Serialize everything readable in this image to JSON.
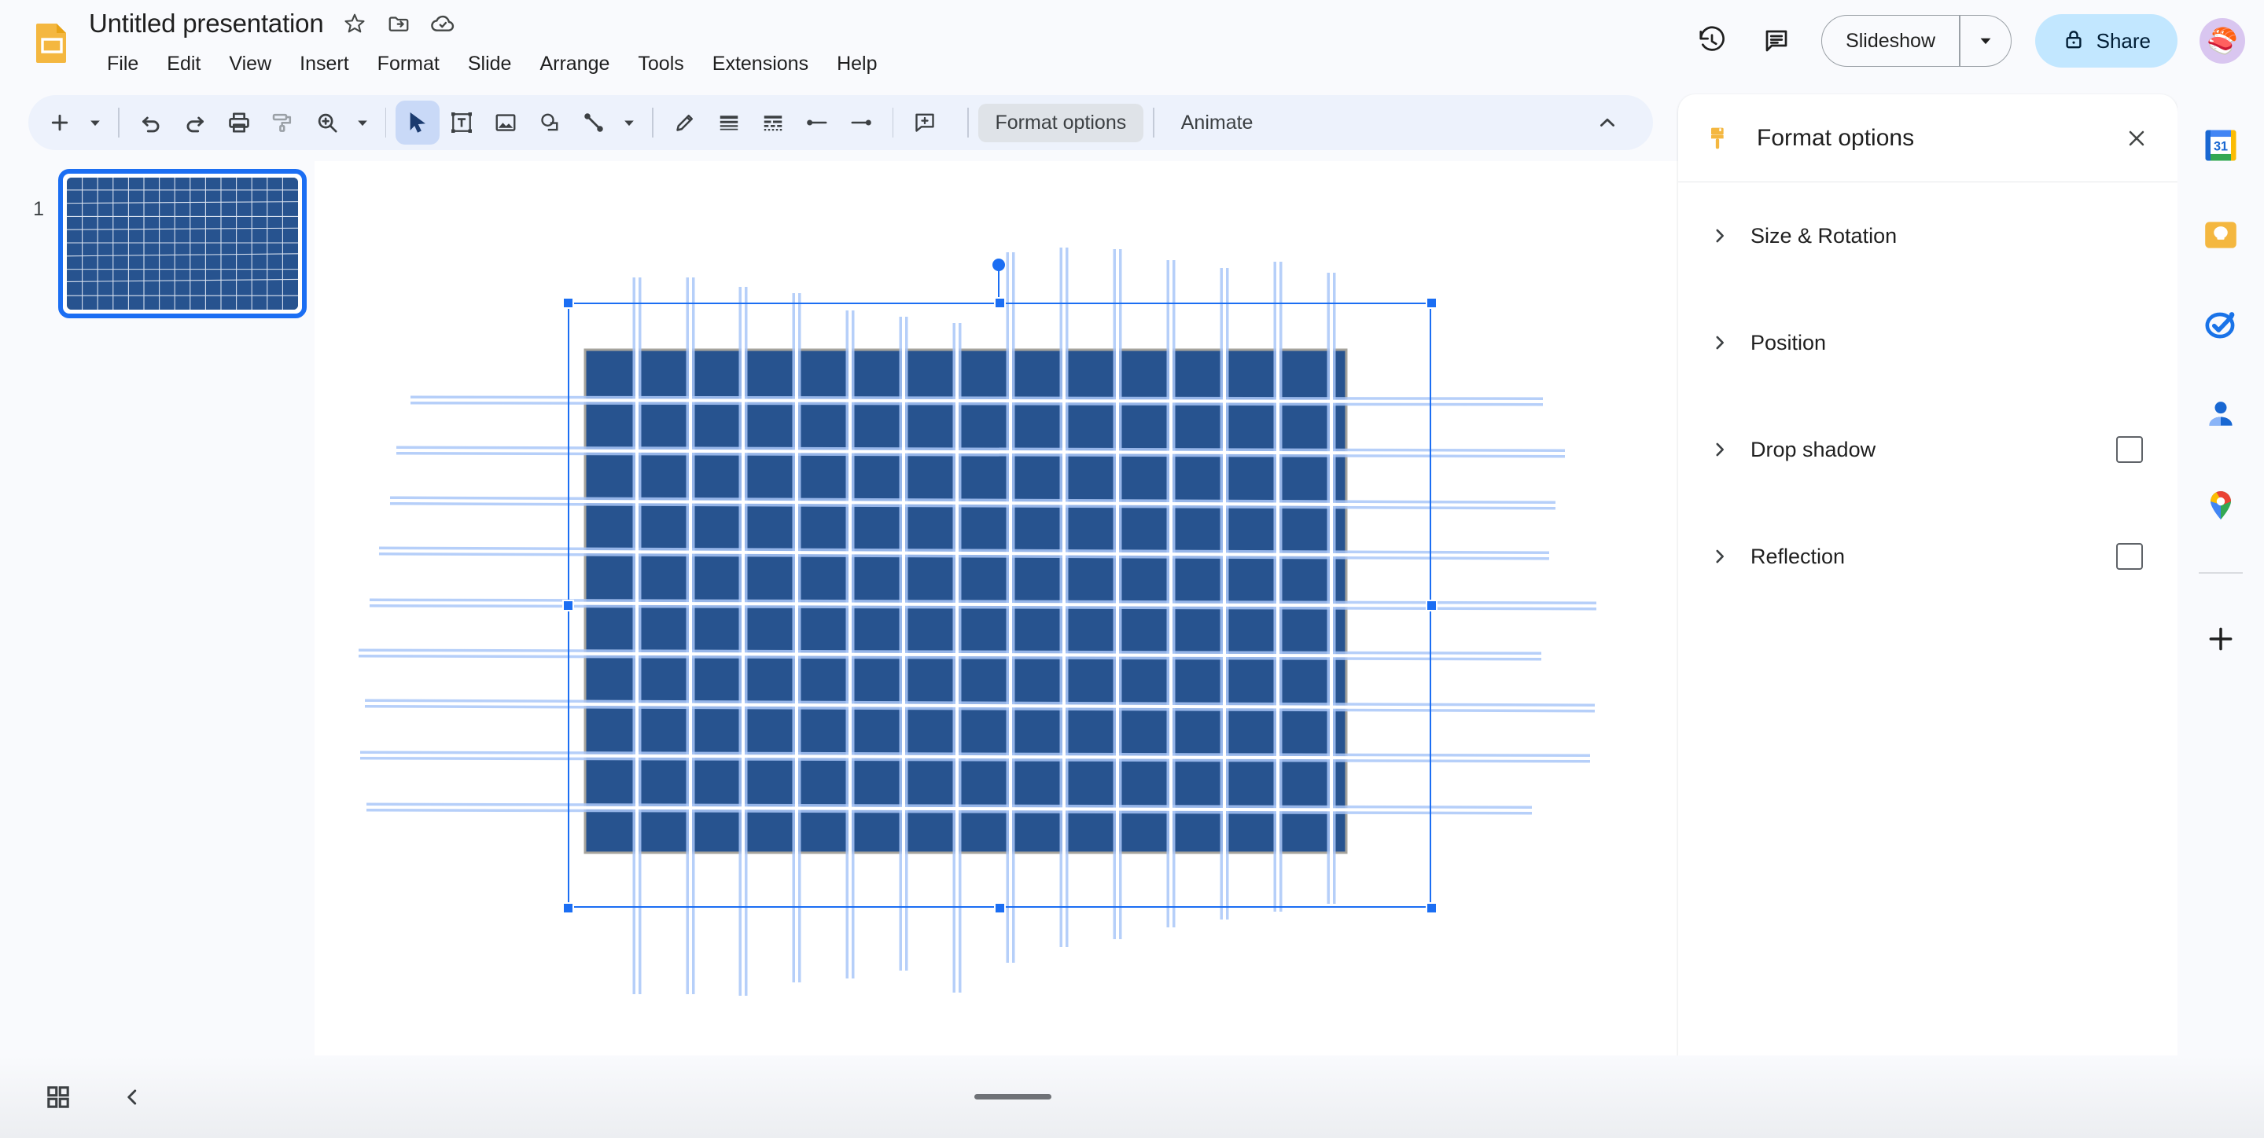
{
  "app": {
    "name": "Google Slides",
    "logo_icon": "slides-logo-icon"
  },
  "header": {
    "title": "Untitled presentation",
    "title_icons": [
      {
        "name": "star-icon",
        "glyph": "star"
      },
      {
        "name": "move-to-folder-icon",
        "glyph": "folder-move"
      },
      {
        "name": "cloud-saved-icon",
        "glyph": "cloud-check"
      }
    ],
    "menus": [
      "File",
      "Edit",
      "View",
      "Insert",
      "Format",
      "Slide",
      "Arrange",
      "Tools",
      "Extensions",
      "Help"
    ],
    "right": {
      "history_icon": "version-history-icon",
      "comments_icon": "comment-history-icon",
      "slideshow_label": "Slideshow",
      "slideshow_caret_icon": "chevron-down-icon",
      "share_label": "Share",
      "share_lock_icon": "lock-icon",
      "avatar_icon": "user-avatar-sushi",
      "avatar_glyph": "🍣"
    }
  },
  "toolbar": {
    "items": [
      {
        "name": "new-slide-button",
        "icon": "plus-icon",
        "type": "icon"
      },
      {
        "name": "new-slide-dropdown",
        "icon": "chevron-down-icon",
        "type": "caret"
      },
      {
        "name": "separator-1",
        "type": "sep"
      },
      {
        "name": "undo-button",
        "icon": "undo-icon",
        "type": "icon"
      },
      {
        "name": "redo-button",
        "icon": "redo-icon",
        "type": "icon"
      },
      {
        "name": "print-button",
        "icon": "printer-icon",
        "type": "icon"
      },
      {
        "name": "paint-format-button",
        "icon": "paint-format-icon",
        "type": "icon"
      },
      {
        "name": "zoom-button",
        "icon": "zoom-in-icon",
        "type": "icon"
      },
      {
        "name": "zoom-dropdown",
        "icon": "chevron-down-icon",
        "type": "caret"
      },
      {
        "name": "separator-2",
        "type": "sep"
      },
      {
        "name": "select-tool-button",
        "icon": "cursor-arrow-icon",
        "type": "icon",
        "active": true
      },
      {
        "name": "text-box-button",
        "icon": "text-box-icon",
        "type": "icon"
      },
      {
        "name": "insert-image-button",
        "icon": "image-icon",
        "type": "icon"
      },
      {
        "name": "shape-button",
        "icon": "shape-icon",
        "type": "icon"
      },
      {
        "name": "line-button",
        "icon": "line-icon",
        "type": "icon"
      },
      {
        "name": "line-dropdown",
        "icon": "chevron-down-icon",
        "type": "caret"
      },
      {
        "name": "separator-3",
        "type": "sep"
      },
      {
        "name": "pen-button",
        "icon": "pencil-icon",
        "type": "icon"
      },
      {
        "name": "line-weight-button",
        "icon": "line-weight-icon",
        "type": "icon"
      },
      {
        "name": "line-dash-button",
        "icon": "line-dash-icon",
        "type": "icon"
      },
      {
        "name": "line-start-button",
        "icon": "line-start-icon",
        "type": "icon"
      },
      {
        "name": "line-end-button",
        "icon": "line-end-icon",
        "type": "icon"
      },
      {
        "name": "separator-4",
        "type": "sep"
      },
      {
        "name": "add-comment-button",
        "icon": "add-comment-icon",
        "type": "icon"
      }
    ],
    "format_options_label": "Format options",
    "animate_label": "Animate",
    "collapse_icon": "chevron-up-icon"
  },
  "filmstrip": {
    "slides": [
      {
        "number": "1",
        "selected": true
      }
    ]
  },
  "canvas": {
    "shape": {
      "name": "grid-rectangle",
      "fill": "#27538f",
      "stroke": "#a5a39c",
      "line_color": "#ffffff",
      "selection_color": "#1b6ef3",
      "selection_halo": "#aac7f8"
    }
  },
  "chart_data": {
    "type": "table",
    "title": "",
    "description": "Dark blue rectangle overlaid by a selected grid of white line shapes",
    "rows": 10,
    "columns": 14,
    "fill_color": "#27538f",
    "line_color": "#ffffff"
  },
  "format_panel": {
    "title": "Format options",
    "icon": "paint-roller-icon",
    "close_icon": "close-icon",
    "sections": [
      {
        "label": "Size & Rotation",
        "expand_icon": "chevron-right-icon",
        "has_checkbox": false,
        "checked": false
      },
      {
        "label": "Position",
        "expand_icon": "chevron-right-icon",
        "has_checkbox": false,
        "checked": false
      },
      {
        "label": "Drop shadow",
        "expand_icon": "chevron-right-icon",
        "has_checkbox": true,
        "checked": false
      },
      {
        "label": "Reflection",
        "expand_icon": "chevron-right-icon",
        "has_checkbox": true,
        "checked": false
      }
    ]
  },
  "rail": {
    "items": [
      {
        "name": "google-calendar-icon",
        "label": "Calendar",
        "day": "31"
      },
      {
        "name": "google-keep-icon",
        "label": "Keep"
      },
      {
        "name": "google-tasks-icon",
        "label": "Tasks"
      },
      {
        "name": "google-contacts-icon",
        "label": "Contacts"
      },
      {
        "name": "google-maps-icon",
        "label": "Maps"
      }
    ],
    "add_label": "Get add-ons",
    "add_icon": "plus-icon",
    "collapse_icon": "chevron-right-icon"
  },
  "bottombar": {
    "grid_view_icon": "grid-view-icon",
    "collapse_filmstrip_icon": "chevron-left-icon",
    "notes_handle_name": "speaker-notes-resize-handle"
  },
  "colors": {
    "accent_blue": "#1b6ef3",
    "share_bg": "#c2e7ff",
    "toolbar_bg": "#edf2fc",
    "shape_fill": "#27538f",
    "app_bg": "#f9fafd"
  }
}
